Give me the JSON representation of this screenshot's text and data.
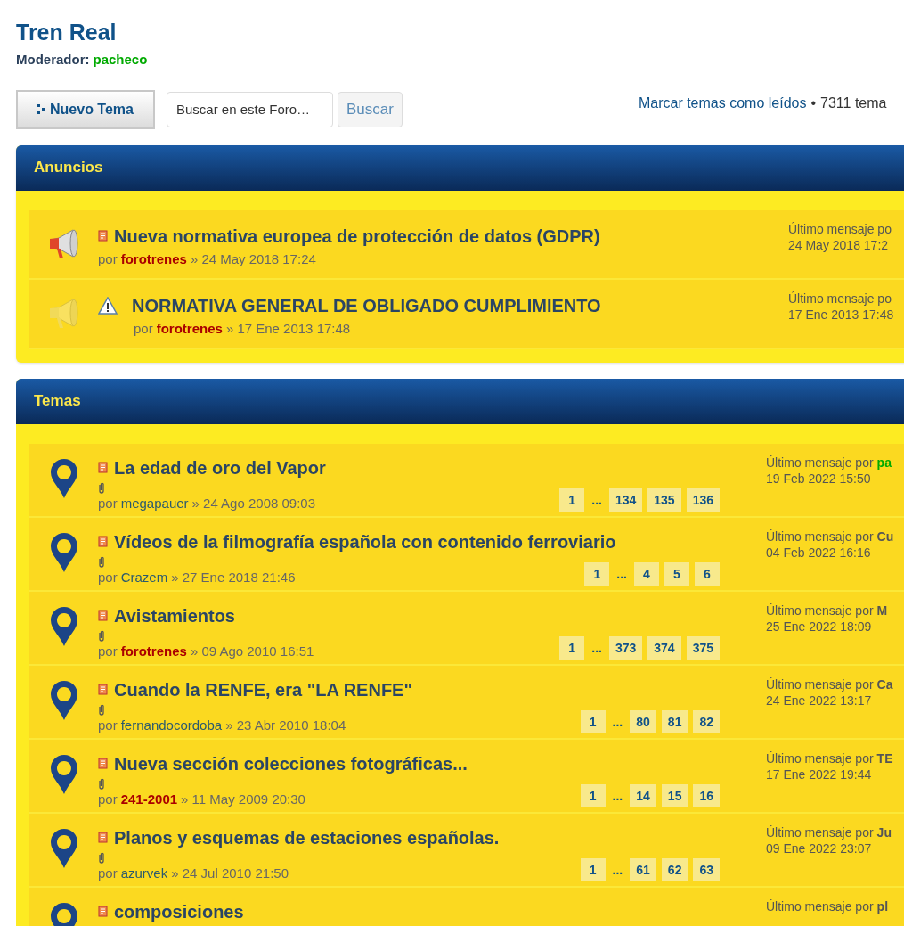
{
  "forum": {
    "title": "Tren Real",
    "moderator_label": "Moderador:",
    "moderator": "pacheco"
  },
  "toolbar": {
    "new_topic": "Nuevo Tema",
    "search": {
      "placeholder": "Buscar en este Foro…"
    },
    "search_button": "Buscar",
    "mark_read": "Marcar temas como leídos",
    "separator": "•",
    "topic_count": "7311 tema"
  },
  "announcements": {
    "heading": "Anuncios",
    "rows": [
      {
        "unread": true,
        "kind": "post",
        "title": "Nueva normativa europea de protección de datos (GDPR)",
        "by": "por",
        "author": {
          "name": "forotrenes",
          "color": "#aa0000"
        },
        "date": "» 24 May 2018 17:24",
        "last_label": "Último mensaje po",
        "last_date": "24 May 2018 17:2"
      },
      {
        "unread": false,
        "kind": "warning",
        "title": "NORMATIVA GENERAL DE OBLIGADO CUMPLIMIENTO",
        "by": "por",
        "author": {
          "name": "forotrenes",
          "color": "#aa0000"
        },
        "date": "» 17 Ene 2013 17:48",
        "last_label": "Último mensaje po",
        "last_date": "17 Ene 2013 17:48"
      }
    ]
  },
  "topics": {
    "heading": "Temas",
    "rows": [
      {
        "title": "La edad de oro del Vapor",
        "by": "por",
        "author": {
          "name": "megapauer",
          "color": "#2b5a6e"
        },
        "date": "» 24 Ago 2008 09:03",
        "pages": [
          {
            "kind": "page",
            "label": "1"
          },
          {
            "kind": "ellipsis",
            "label": "..."
          },
          {
            "kind": "page",
            "label": "134"
          },
          {
            "kind": "page",
            "label": "135"
          },
          {
            "kind": "page",
            "label": "136"
          }
        ],
        "last_label": "Último mensaje por",
        "last_author": {
          "name": "pa",
          "color": "#00aa00"
        },
        "last_date": "19 Feb 2022 15:50"
      },
      {
        "title": "Vídeos de la filmografía española con contenido ferroviario",
        "by": "por",
        "author": {
          "name": "Crazem",
          "color": "#2b5a6e"
        },
        "date": "» 27 Ene 2018 21:46",
        "pages": [
          {
            "kind": "page",
            "label": "1"
          },
          {
            "kind": "ellipsis",
            "label": "..."
          },
          {
            "kind": "page",
            "label": "4"
          },
          {
            "kind": "page",
            "label": "5"
          },
          {
            "kind": "page",
            "label": "6"
          }
        ],
        "last_label": "Último mensaje por",
        "last_author": {
          "name": "Cu",
          "color": "#555555"
        },
        "last_date": "04 Feb 2022 16:16"
      },
      {
        "title": "Avistamientos",
        "by": "por",
        "author": {
          "name": "forotrenes",
          "color": "#aa0000"
        },
        "date": "» 09 Ago 2010 16:51",
        "pages": [
          {
            "kind": "page",
            "label": "1"
          },
          {
            "kind": "ellipsis",
            "label": "..."
          },
          {
            "kind": "page",
            "label": "373"
          },
          {
            "kind": "page",
            "label": "374"
          },
          {
            "kind": "page",
            "label": "375"
          }
        ],
        "last_label": "Último mensaje por",
        "last_author": {
          "name": "M",
          "color": "#555555"
        },
        "last_date": "25 Ene 2022 18:09"
      },
      {
        "title": "Cuando la RENFE, era \"LA RENFE\"",
        "by": "por",
        "author": {
          "name": "fernandocordoba",
          "color": "#2b5a6e"
        },
        "date": "» 23 Abr 2010 18:04",
        "pages": [
          {
            "kind": "page",
            "label": "1"
          },
          {
            "kind": "ellipsis",
            "label": "..."
          },
          {
            "kind": "page",
            "label": "80"
          },
          {
            "kind": "page",
            "label": "81"
          },
          {
            "kind": "page",
            "label": "82"
          }
        ],
        "last_label": "Último mensaje por",
        "last_author": {
          "name": "Ca",
          "color": "#555555"
        },
        "last_date": "24 Ene 2022 13:17"
      },
      {
        "title": "Nueva sección colecciones fotográficas...",
        "by": "por",
        "author": {
          "name": "241-2001",
          "color": "#aa0000"
        },
        "date": "» 11 May 2009 20:30",
        "pages": [
          {
            "kind": "page",
            "label": "1"
          },
          {
            "kind": "ellipsis",
            "label": "..."
          },
          {
            "kind": "page",
            "label": "14"
          },
          {
            "kind": "page",
            "label": "15"
          },
          {
            "kind": "page",
            "label": "16"
          }
        ],
        "last_label": "Último mensaje por",
        "last_author": {
          "name": "TE",
          "color": "#555555"
        },
        "last_date": "17 Ene 2022 19:44"
      },
      {
        "title": "Planos y esquemas de estaciones españolas.",
        "by": "por",
        "author": {
          "name": "azurvek",
          "color": "#2b5a6e"
        },
        "date": "» 24 Jul 2010 21:50",
        "pages": [
          {
            "kind": "page",
            "label": "1"
          },
          {
            "kind": "ellipsis",
            "label": "..."
          },
          {
            "kind": "page",
            "label": "61"
          },
          {
            "kind": "page",
            "label": "62"
          },
          {
            "kind": "page",
            "label": "63"
          }
        ],
        "last_label": "Último mensaje por",
        "last_author": {
          "name": "Ju",
          "color": "#555555"
        },
        "last_date": "09 Ene 2022 23:07"
      },
      {
        "title": "composiciones",
        "last_label": "Último mensaje por",
        "last_author": {
          "name": "pl",
          "color": "#555555"
        }
      }
    ]
  }
}
